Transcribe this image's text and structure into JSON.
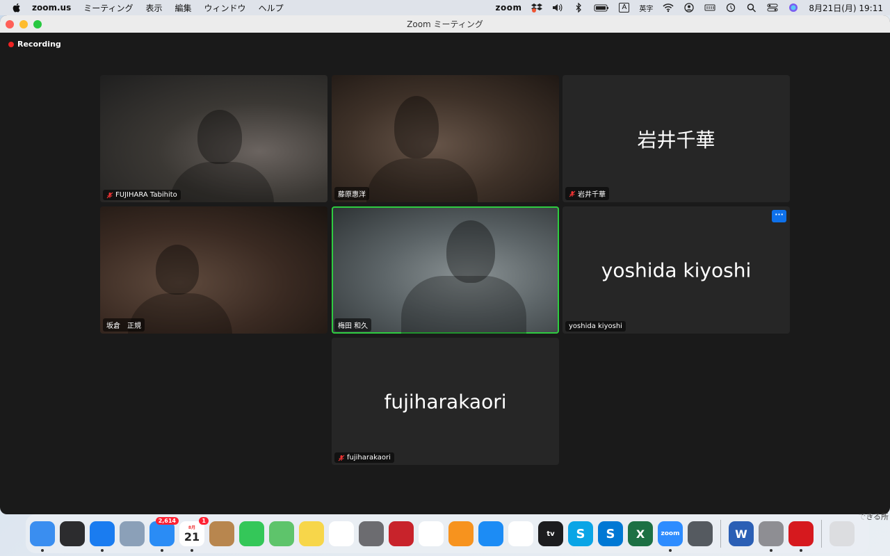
{
  "menubar": {
    "app_name": "zoom.us",
    "menus": [
      "ミーティング",
      "表示",
      "編集",
      "ウィンドウ",
      "ヘルプ"
    ],
    "zoom_label": "zoom",
    "ime_box": "A",
    "ime_label": "英字",
    "clock": "8月21日(月)  19:11"
  },
  "window": {
    "title": "Zoom ミーティング",
    "recording_label": "Recording"
  },
  "tiles": [
    {
      "name": "FUJIHARA Tabihito",
      "muted": true,
      "video": true
    },
    {
      "name": "藤原惠洋",
      "muted": false,
      "video": true
    },
    {
      "name": "岩井千華",
      "center_name": "岩井千華",
      "muted": true,
      "video": false
    },
    {
      "name": "坂倉　正規",
      "muted": false,
      "video": true
    },
    {
      "name": "梅田 和久",
      "muted": false,
      "video": true,
      "active_speaker": true
    },
    {
      "name": "yoshida  kiyoshi",
      "center_name": "yoshida  kiyoshi",
      "muted": false,
      "video": false,
      "more_button": "···"
    },
    {
      "name": "fujiharakaori",
      "center_name": "fujiharakaori",
      "muted": true,
      "video": false
    }
  ],
  "dock": {
    "apps": [
      {
        "icon": "finder-icon",
        "color": "#3a8ef0"
      },
      {
        "icon": "mission-control-icon",
        "color": "#2c2c2e"
      },
      {
        "icon": "safari-icon",
        "color": "#1a7cf0"
      },
      {
        "icon": "preview-icon",
        "color": "#8ba0b8"
      },
      {
        "icon": "mail-icon",
        "color": "#2a8cf5",
        "badge": "2,614"
      },
      {
        "icon": "calendar-icon",
        "color": "#ffffff",
        "label": "21",
        "month": "8月",
        "badge": "1"
      },
      {
        "icon": "contacts-icon",
        "color": "#b8864e"
      },
      {
        "icon": "messages-icon",
        "color": "#34c759"
      },
      {
        "icon": "maps-icon",
        "color": "#5ec46b"
      },
      {
        "icon": "notes-icon",
        "color": "#f7d64a"
      },
      {
        "icon": "freeform-icon",
        "color": "#ffffff"
      },
      {
        "icon": "launchpad-icon",
        "color": "#6c6c70"
      },
      {
        "icon": "photo-booth-icon",
        "color": "#c8232b"
      },
      {
        "icon": "photos-icon",
        "color": "#ffffff"
      },
      {
        "icon": "books-icon",
        "color": "#f7931e"
      },
      {
        "icon": "app-store-icon",
        "color": "#1c8cf5"
      },
      {
        "icon": "reminders-icon",
        "color": "#ffffff"
      },
      {
        "icon": "apple-tv-icon",
        "color": "#1c1c1e",
        "label": "tv"
      },
      {
        "icon": "skype-icon",
        "color": "#0aa5e6",
        "label": "S"
      },
      {
        "icon": "skype-icon-2",
        "color": "#0078d4",
        "label": "S"
      },
      {
        "icon": "excel-icon",
        "color": "#1d7044",
        "label": "X"
      },
      {
        "icon": "zoom-icon",
        "color": "#2d8cff",
        "label": "zoom"
      },
      {
        "icon": "prism-icon",
        "color": "#555a60"
      },
      {
        "icon": "word-icon",
        "color": "#2b5fb5",
        "label": "W"
      },
      {
        "icon": "system-settings-icon",
        "color": "#8e8e93"
      },
      {
        "icon": "trend-micro-icon",
        "color": "#d6191e"
      },
      {
        "icon": "trash-icon",
        "color": "#dcdde0"
      }
    ]
  },
  "background_text": "できる所"
}
